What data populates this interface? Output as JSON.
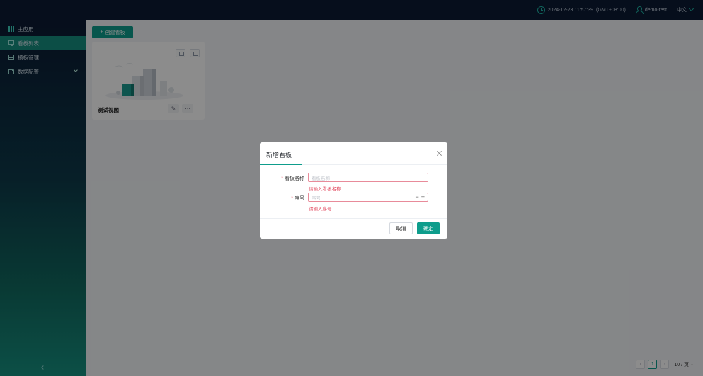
{
  "header": {
    "datetime": "2024-12-23 11:57:39",
    "timezone": "(GMT+08:00)",
    "username": "demo-test",
    "language": "中文"
  },
  "sidebar": {
    "items": [
      {
        "label": "主应用",
        "icon": "grid-icon"
      },
      {
        "label": "看板列表",
        "icon": "monitor-icon",
        "active": true
      },
      {
        "label": "模板管理",
        "icon": "template-icon"
      },
      {
        "label": "数据配置",
        "icon": "folder-icon",
        "expandable": true
      }
    ]
  },
  "main": {
    "create_button": "创建看板",
    "card": {
      "title": "测试视图"
    },
    "pagination": {
      "current_page": "1",
      "page_size": "10 / 页"
    }
  },
  "modal": {
    "title": "新增看板",
    "fields": {
      "name": {
        "label": "看板名称",
        "placeholder": "看板名称",
        "error": "请输入看板名称"
      },
      "order": {
        "label": "序号",
        "placeholder": "序号",
        "error": "请输入序号"
      }
    },
    "cancel_label": "取消",
    "ok_label": "确定"
  },
  "colors": {
    "accent": "#0e9d8c",
    "error": "#e2475d",
    "header_bg": "#0b1a33"
  }
}
